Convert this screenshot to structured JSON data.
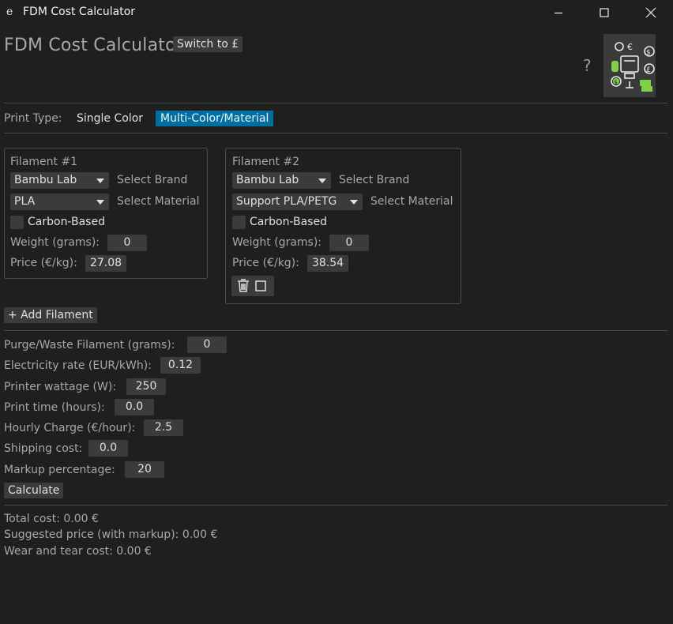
{
  "window": {
    "app_icon": "e",
    "title": "FDM Cost Calculator"
  },
  "header": {
    "title": "FDM Cost Calculator",
    "currency_toggle": "Switch to £",
    "help": "?"
  },
  "print_type": {
    "label": "Print Type:",
    "options": [
      "Single Color",
      "Multi-Color/Material"
    ],
    "selected": "Multi-Color/Material"
  },
  "filaments": [
    {
      "title": "Filament #1",
      "brand": "Bambu Lab",
      "brand_label": "Select Brand",
      "material": "PLA",
      "material_label": "Select Material",
      "carbon_label": "Carbon-Based",
      "weight_label": "Weight (grams):",
      "weight": "0",
      "price_label": "Price (€/kg):",
      "price": "27.08"
    },
    {
      "title": "Filament #2",
      "brand": "Bambu Lab",
      "brand_label": "Select Brand",
      "material": "Support PLA/PETG",
      "material_label": "Select Material",
      "carbon_label": "Carbon-Based",
      "weight_label": "Weight (grams):",
      "weight": "0",
      "price_label": "Price (€/kg):",
      "price": "38.54"
    }
  ],
  "add_filament": "+ Add Filament",
  "fields": {
    "purge": {
      "label": "Purge/Waste Filament (grams):",
      "value": "0"
    },
    "electricity": {
      "label": "Electricity rate (EUR/kWh):",
      "value": "0.12"
    },
    "wattage": {
      "label": "Printer wattage (W):",
      "value": "250"
    },
    "print_time": {
      "label": "Print time (hours):",
      "value": "0.0"
    },
    "hourly": {
      "label": "Hourly Charge (€/hour):",
      "value": "2.5"
    },
    "shipping": {
      "label": "Shipping cost:",
      "value": "0.0"
    },
    "markup": {
      "label": "Markup percentage:",
      "value": "20"
    }
  },
  "calculate": "Calculate",
  "results": {
    "total": "Total cost: 0.00 €",
    "suggested": "Suggested price (with markup): 0.00 €",
    "wear": "Wear and tear cost: 0.00 €"
  },
  "icons": {
    "minimize": "minimize-icon",
    "maximize": "maximize-icon",
    "close": "close-icon",
    "delete": "trash-icon",
    "logo": "cost-calculator-logo"
  },
  "colors": {
    "background": "#1f1f1f",
    "control": "#3b3b3b",
    "accent": "#006fa0",
    "logo_green": "#7fd14a"
  }
}
